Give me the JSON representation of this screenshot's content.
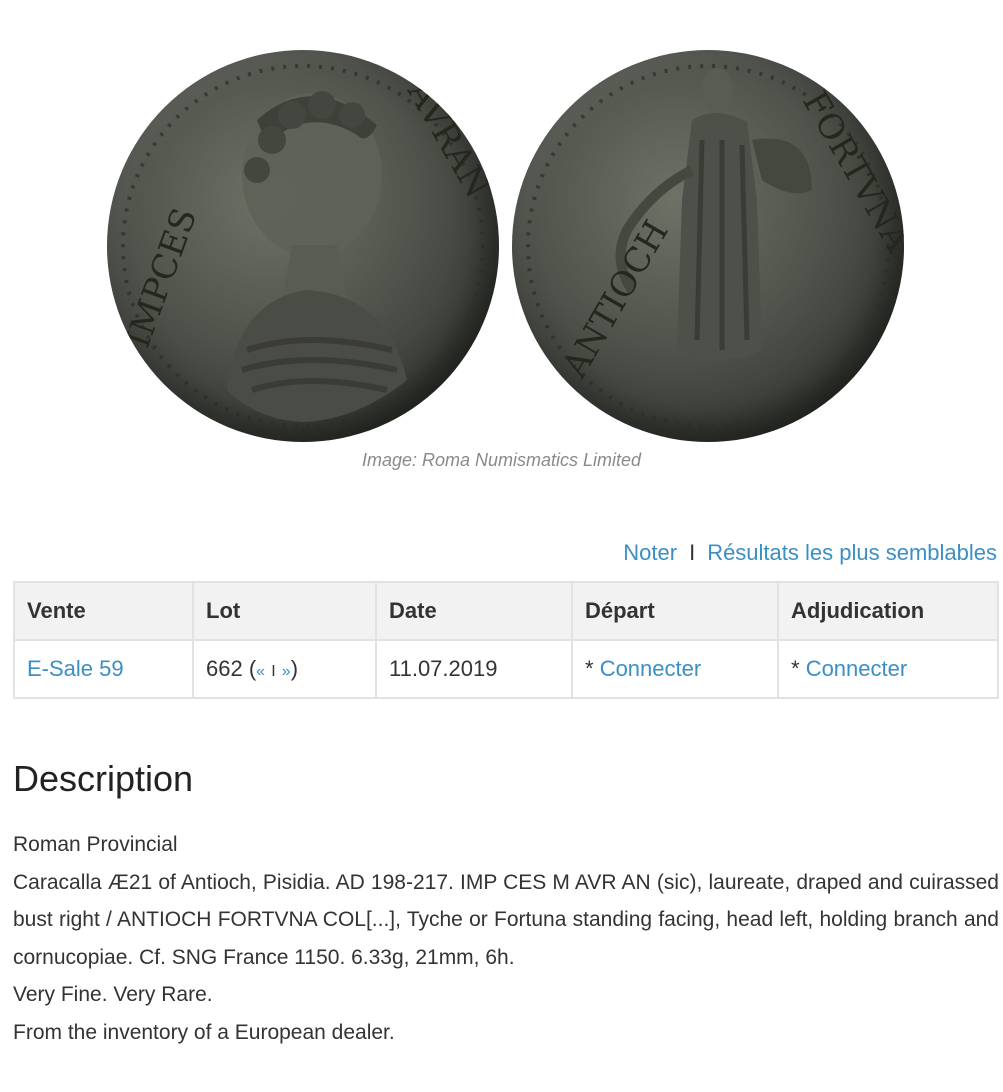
{
  "image_credit": "Image: Roma Numismatics Limited",
  "actions": {
    "note_label": "Noter",
    "separator": "I",
    "similar_label": "Résultats les plus semblables"
  },
  "table": {
    "headers": [
      "Vente",
      "Lot",
      "Date",
      "Départ",
      "Adjudication"
    ],
    "row": {
      "sale": "E-Sale 59",
      "lot_number": "662",
      "lot_open": "(",
      "prev": "«",
      "lot_sep": "I",
      "next": "»",
      "lot_close": ")",
      "date": "11.07.2019",
      "start_prefix": "*",
      "start_link": "Connecter",
      "hammer_prefix": "*",
      "hammer_link": "Connecter"
    }
  },
  "description": {
    "title": "Description",
    "category": "Roman Provincial",
    "text": "Caracalla Æ21 of Antioch, Pisidia. AD 198-217. IMP CES M AVR AN (sic), laureate, draped and cuirassed bust right / ANTIOCH FORTVNA COL[...], Tyche or Fortuna standing facing, head left, holding branch and cornucopiae. Cf. SNG France 1150. 6.33g, 21mm, 6h.",
    "grade": "Very Fine. Very Rare.",
    "provenance": "From the inventory of a European dealer."
  },
  "colors": {
    "link": "#3a8fc4",
    "header_bg": "#f2f2f2",
    "border": "#e2e2e2",
    "caption": "#8a8a8a"
  },
  "icons": [
    "coin-obverse-image",
    "coin-reverse-image"
  ]
}
